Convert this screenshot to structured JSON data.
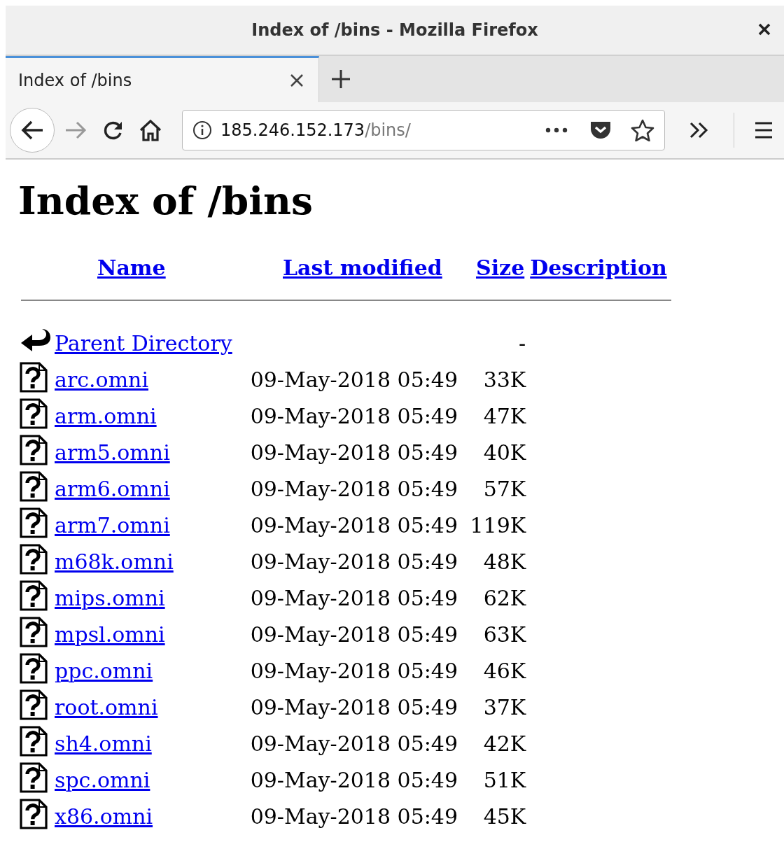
{
  "window": {
    "title": "Index of /bins - Mozilla Firefox"
  },
  "tabs": [
    {
      "label": "Index of /bins",
      "selected": true
    }
  ],
  "address_bar": {
    "host": "185.246.152.173",
    "path": "/bins/"
  },
  "page": {
    "heading": "Index of /bins",
    "columns": [
      "Name",
      "Last modified",
      "Size",
      "Description"
    ],
    "rows": [
      {
        "kind": "parent",
        "name": "Parent Directory",
        "modified": "",
        "size": "-"
      },
      {
        "kind": "file",
        "name": "arc.omni",
        "modified": "09-May-2018 05:49",
        "size": "33K"
      },
      {
        "kind": "file",
        "name": "arm.omni",
        "modified": "09-May-2018 05:49",
        "size": "47K"
      },
      {
        "kind": "file",
        "name": "arm5.omni",
        "modified": "09-May-2018 05:49",
        "size": "40K"
      },
      {
        "kind": "file",
        "name": "arm6.omni",
        "modified": "09-May-2018 05:49",
        "size": "57K"
      },
      {
        "kind": "file",
        "name": "arm7.omni",
        "modified": "09-May-2018 05:49",
        "size": "119K"
      },
      {
        "kind": "file",
        "name": "m68k.omni",
        "modified": "09-May-2018 05:49",
        "size": "48K"
      },
      {
        "kind": "file",
        "name": "mips.omni",
        "modified": "09-May-2018 05:49",
        "size": "62K"
      },
      {
        "kind": "file",
        "name": "mpsl.omni",
        "modified": "09-May-2018 05:49",
        "size": "63K"
      },
      {
        "kind": "file",
        "name": "ppc.omni",
        "modified": "09-May-2018 05:49",
        "size": "46K"
      },
      {
        "kind": "file",
        "name": "root.omni",
        "modified": "09-May-2018 05:49",
        "size": "37K"
      },
      {
        "kind": "file",
        "name": "sh4.omni",
        "modified": "09-May-2018 05:49",
        "size": "42K"
      },
      {
        "kind": "file",
        "name": "spc.omni",
        "modified": "09-May-2018 05:49",
        "size": "51K"
      },
      {
        "kind": "file",
        "name": "x86.omni",
        "modified": "09-May-2018 05:49",
        "size": "45K"
      }
    ]
  }
}
